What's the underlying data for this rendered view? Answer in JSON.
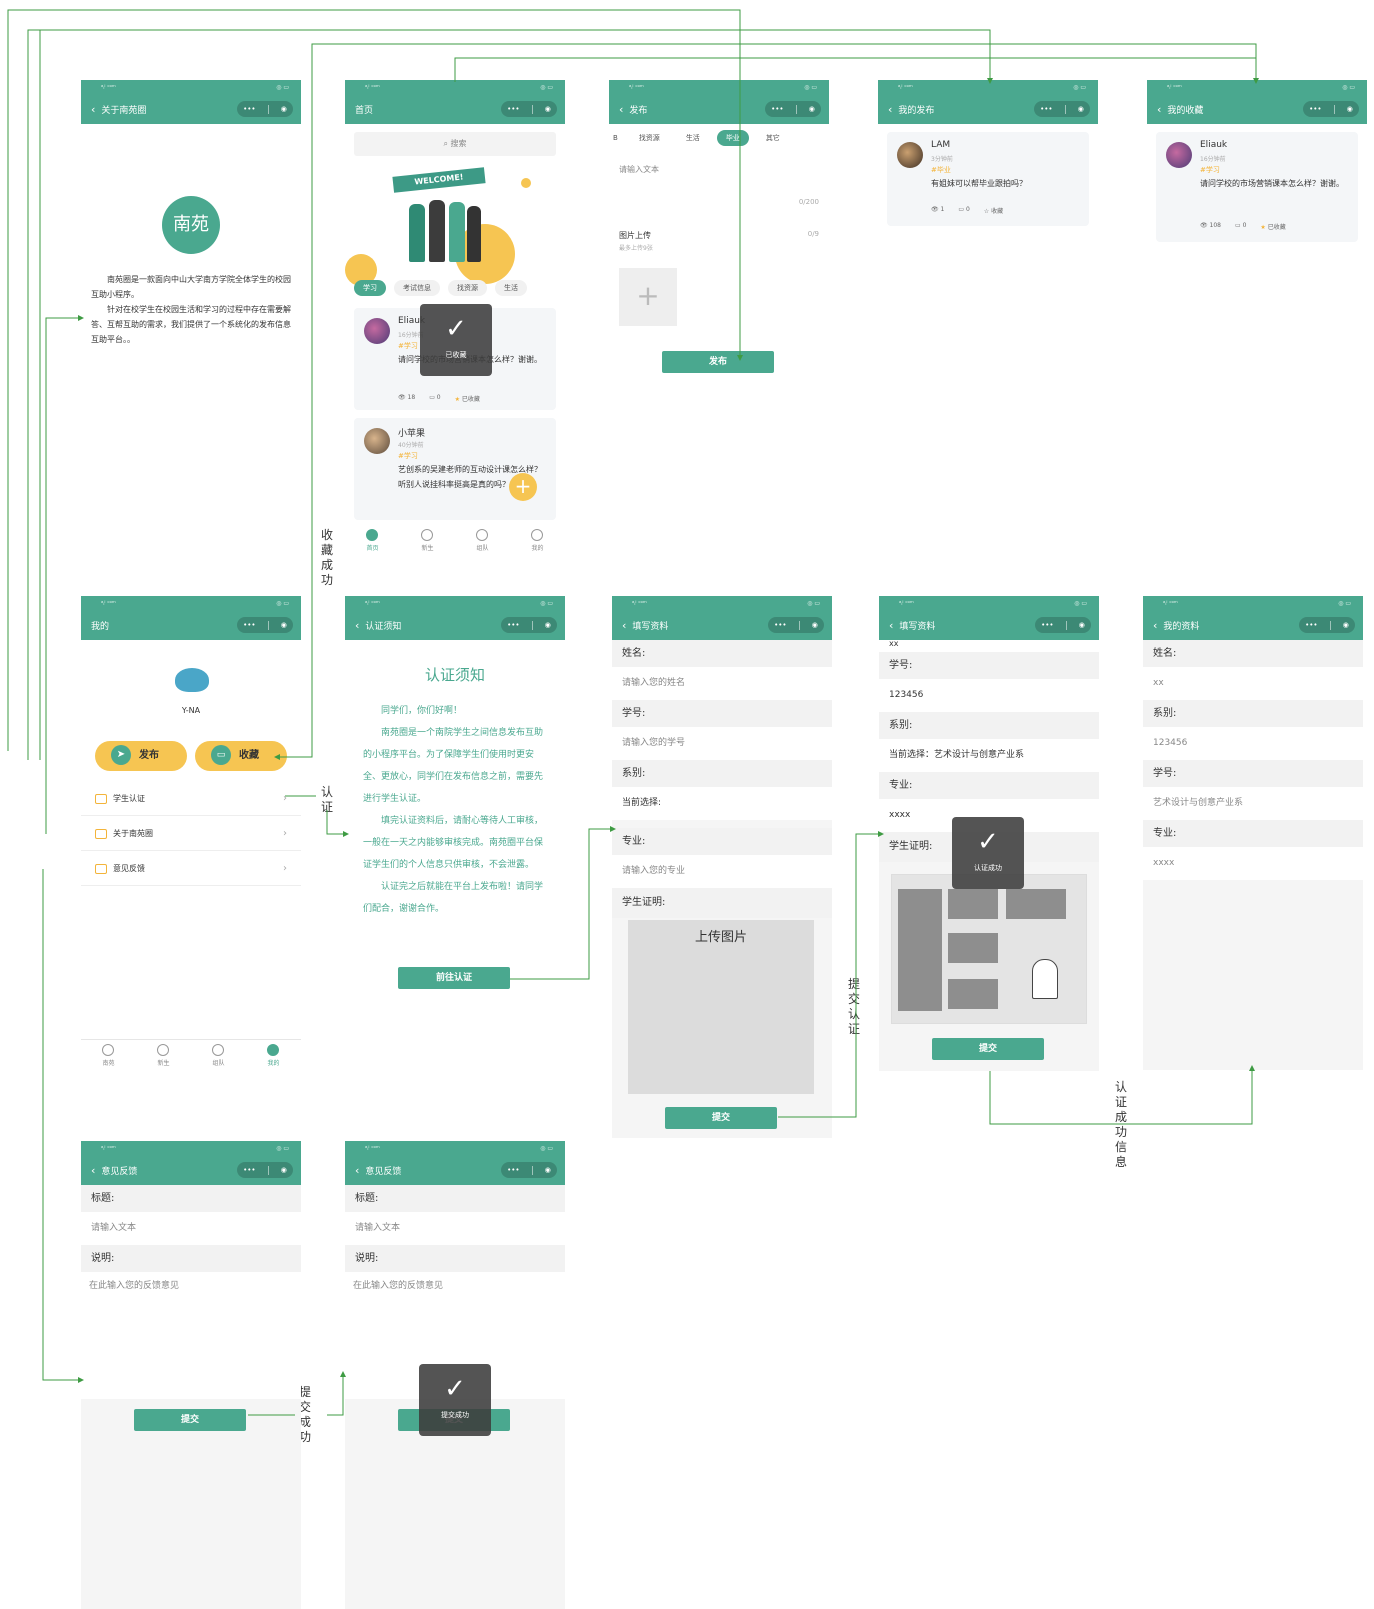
{
  "statusbar": {
    "left": "ᵃᵢˡ ᶜᵒᵐ",
    "right": "◎ ▭"
  },
  "capsule": {
    "dots": "•••",
    "target": "◉"
  },
  "s_about": {
    "title": "关于南苑圈",
    "logo_text": "南苑",
    "para1": "南苑圈是一款面向中山大学南方学院全体学生的校园互助小程序。",
    "para2": "针对在校学生在校园生活和学习的过程中存在需要解答、互帮互助的需求，我们提供了一个系统化的发布信息互助平台。。"
  },
  "s_home": {
    "title": "首页",
    "search_placeholder": "搜索",
    "welcome": "WELCOME!",
    "tabs": [
      "学习",
      "考试信息",
      "找资源",
      "生活"
    ],
    "card1": {
      "name": "Eliauk",
      "time": "16分钟前",
      "tag": "#学习",
      "content": "请问学校的市场营销课本怎么样？谢谢。",
      "views": "18",
      "comments": "0",
      "collect": "已收藏"
    },
    "card2": {
      "name": "小苹果",
      "time": "40分钟前",
      "tag": "#学习",
      "content": "艺创系的吴建老师的互动设计课怎么样？听别人说挂科率挺高是真的吗？"
    },
    "toast": "已收藏",
    "fab": "+",
    "tabbar": [
      "首页",
      "新生",
      "组队",
      "我的"
    ]
  },
  "s_publish": {
    "title": "发布",
    "cats": [
      "B",
      "找资源",
      "生活",
      "毕业",
      "其它"
    ],
    "text_placeholder": "请输入文本",
    "text_counter": "0/200",
    "image_title": "图片上传",
    "image_hint": "最多上传9张",
    "image_counter": "0/9",
    "plus": "+",
    "submit": "发布"
  },
  "s_mypub": {
    "title": "我的发布",
    "card": {
      "name": "LAM",
      "time": "3分钟前",
      "tag": "#毕业",
      "content": "有姐妹可以帮毕业跟拍吗？",
      "views": "1",
      "comments": "0",
      "collect": "收藏"
    }
  },
  "s_mycol": {
    "title": "我的收藏",
    "card": {
      "name": "Eliauk",
      "time": "16分钟前",
      "tag": "#学习",
      "content": "请问学校的市场营销课本怎么样？谢谢。",
      "views": "108",
      "comments": "0",
      "collect": "已收藏"
    }
  },
  "s_me": {
    "title": "我的",
    "username": "Y-NA",
    "btn_publish": "发布",
    "btn_collect": "收藏",
    "menu": [
      "学生认证",
      "关于南苑圈",
      "意见反馈"
    ],
    "tabbar": [
      "南苑",
      "新生",
      "组队",
      "我的"
    ]
  },
  "s_notice": {
    "title": "认证须知",
    "heading": "认证须知",
    "p1": "同学们，你们好啊！",
    "p2": "南苑圈是一个南院学生之间信息发布互助的小程序平台。为了保障学生们使用时更安全、更放心，同学们在发布信息之前，需要先进行学生认证。",
    "p3": "填完认证资料后，请耐心等待人工审核，一般在一天之内能够审核完成。南苑圈平台保证学生们的个人信息只供审核，不会泄露。",
    "p4": "认证完之后就能在平台上发布啦！请同学们配合，谢谢合作。",
    "btn": "前往认证"
  },
  "s_fill1": {
    "title": "填写资料",
    "name_label": "姓名:",
    "name_ph": "请输入您的姓名",
    "id_label": "学号:",
    "id_ph": "请输入您的学号",
    "dept_label": "系别:",
    "dept_current": "当前选择:",
    "major_label": "专业:",
    "major_ph": "请输入您的专业",
    "proof_label": "学生证明:",
    "upload": "上传图片",
    "submit": "提交"
  },
  "s_fill2": {
    "title": "填写资料",
    "top_val": "xx",
    "id_label": "学号:",
    "id_val": "123456",
    "dept_label": "系别:",
    "dept_val": "当前选择：艺术设计与创意产业系",
    "major_label": "专业:",
    "major_val": "xxxx",
    "proof_label": "学生证明:",
    "toast": "认证成功",
    "submit": "提交"
  },
  "s_profile": {
    "title": "我的资料",
    "name_label": "姓名:",
    "name_val": "xx",
    "dept_label": "系别:",
    "dept_val": "123456",
    "id_label": "学号:",
    "id_val": "艺术设计与创意产业系",
    "major_label": "专业:",
    "major_val": "xxxx"
  },
  "s_fb1": {
    "title": "意见反馈",
    "title_label": "标题:",
    "title_ph": "请输入文本",
    "desc_label": "说明:",
    "desc_ph": "在此输入您的反馈意见",
    "submit": "提交"
  },
  "s_fb2": {
    "title": "意见反馈",
    "title_label": "标题:",
    "title_ph": "请输入文本",
    "desc_label": "说明:",
    "desc_ph": "在此输入您的反馈意见",
    "toast": "提交成功",
    "submit": "提交"
  },
  "labels": {
    "collect_success": "收藏成功",
    "certify": "认证",
    "submit_certify": "提交认证",
    "certify_success_info": "认证成功信息",
    "submit_success": "提交成功"
  },
  "colors": {
    "primary": "#4aa88f",
    "accent": "#f3b43a"
  }
}
